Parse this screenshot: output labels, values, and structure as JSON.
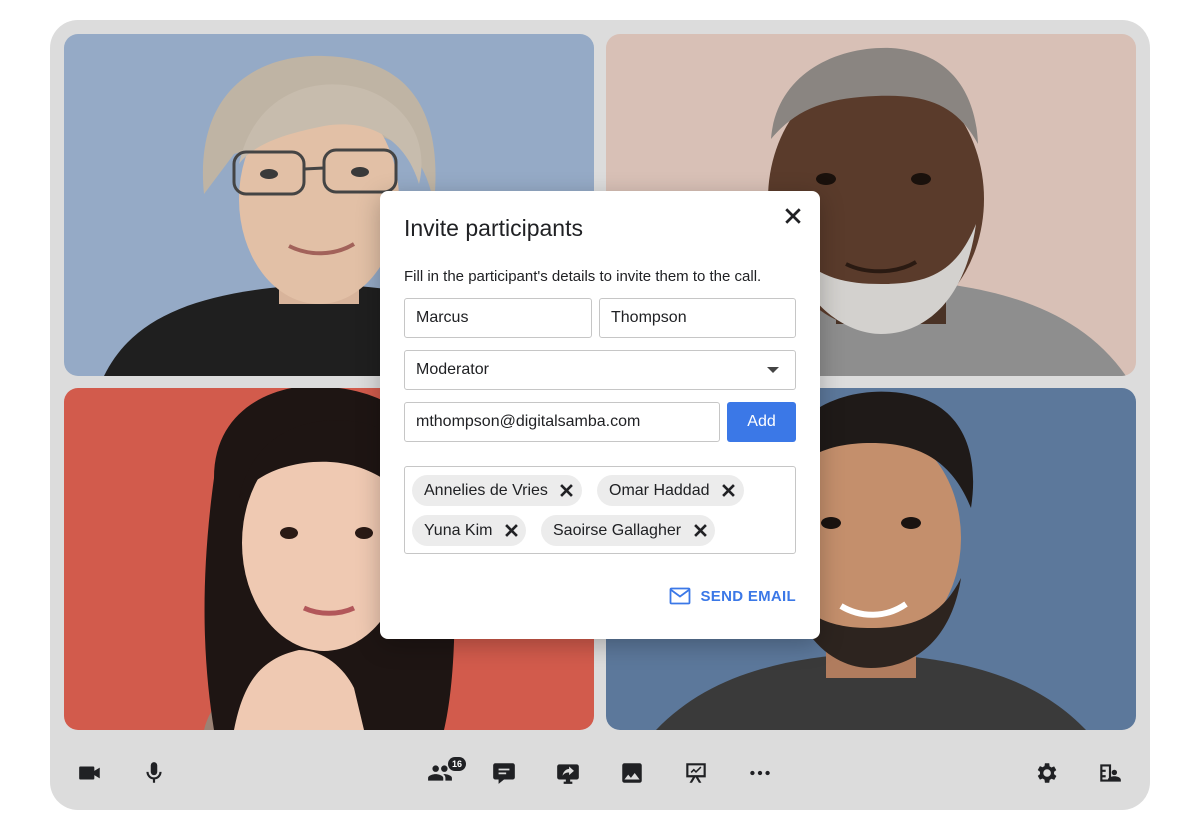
{
  "dialog": {
    "title": "Invite participants",
    "description": "Fill in the participant's details to invite them to the call.",
    "first_name": "Marcus",
    "last_name": "Thompson",
    "role": "Moderator",
    "email": "mthompson@digitalsamba.com",
    "add_label": "Add",
    "send_label": "SEND EMAIL",
    "invitees": [
      "Annelies de Vries",
      "Omar Haddad",
      "Yuna Kim",
      "Saoirse Gallagher"
    ]
  },
  "toolbar": {
    "participants_count": "16"
  },
  "colors": {
    "accent": "#3b78e7",
    "frame": "#dcdcdc",
    "tile_1_bg": "#95aac6",
    "tile_2_bg": "#d8c0b6",
    "tile_3_bg": "#d25b4c",
    "tile_4_bg": "#5c789b"
  },
  "icons": [
    "camera-icon",
    "microphone-icon",
    "participants-icon",
    "chat-icon",
    "screen-share-icon",
    "gallery-icon",
    "whiteboard-icon",
    "more-icon",
    "settings-icon",
    "invite-icon",
    "close-icon",
    "remove-icon",
    "mail-icon",
    "dropdown-caret-icon"
  ]
}
